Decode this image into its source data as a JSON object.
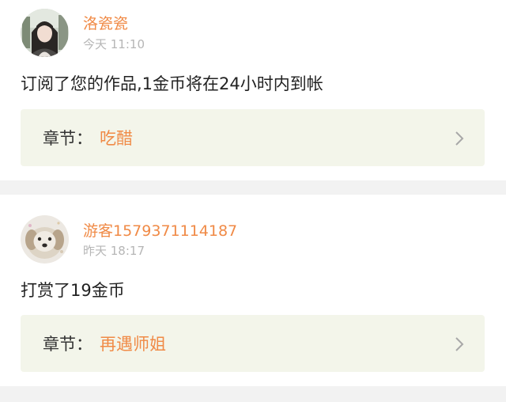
{
  "colors": {
    "accent": "#f08a46",
    "timestamp": "#b6b6b6",
    "chapter_bg": "#f3f5ea",
    "chevron": "#a8a8a8"
  },
  "notifications": [
    {
      "username": "洛瓷瓷",
      "time": "今天 11:10",
      "message": "订阅了您的作品,1金币将在24小时内到帐",
      "chapter_label": "章节：",
      "chapter_name": "吃醋",
      "avatar_icon": "user-avatar-girl",
      "chevron_icon": "chevron-right-icon"
    },
    {
      "username": "游客1579371114187",
      "time": "昨天 18:17",
      "message": "打赏了19金币",
      "chapter_label": "章节：",
      "chapter_name": "再遇师姐",
      "avatar_icon": "user-avatar-dog",
      "chevron_icon": "chevron-right-icon"
    }
  ]
}
